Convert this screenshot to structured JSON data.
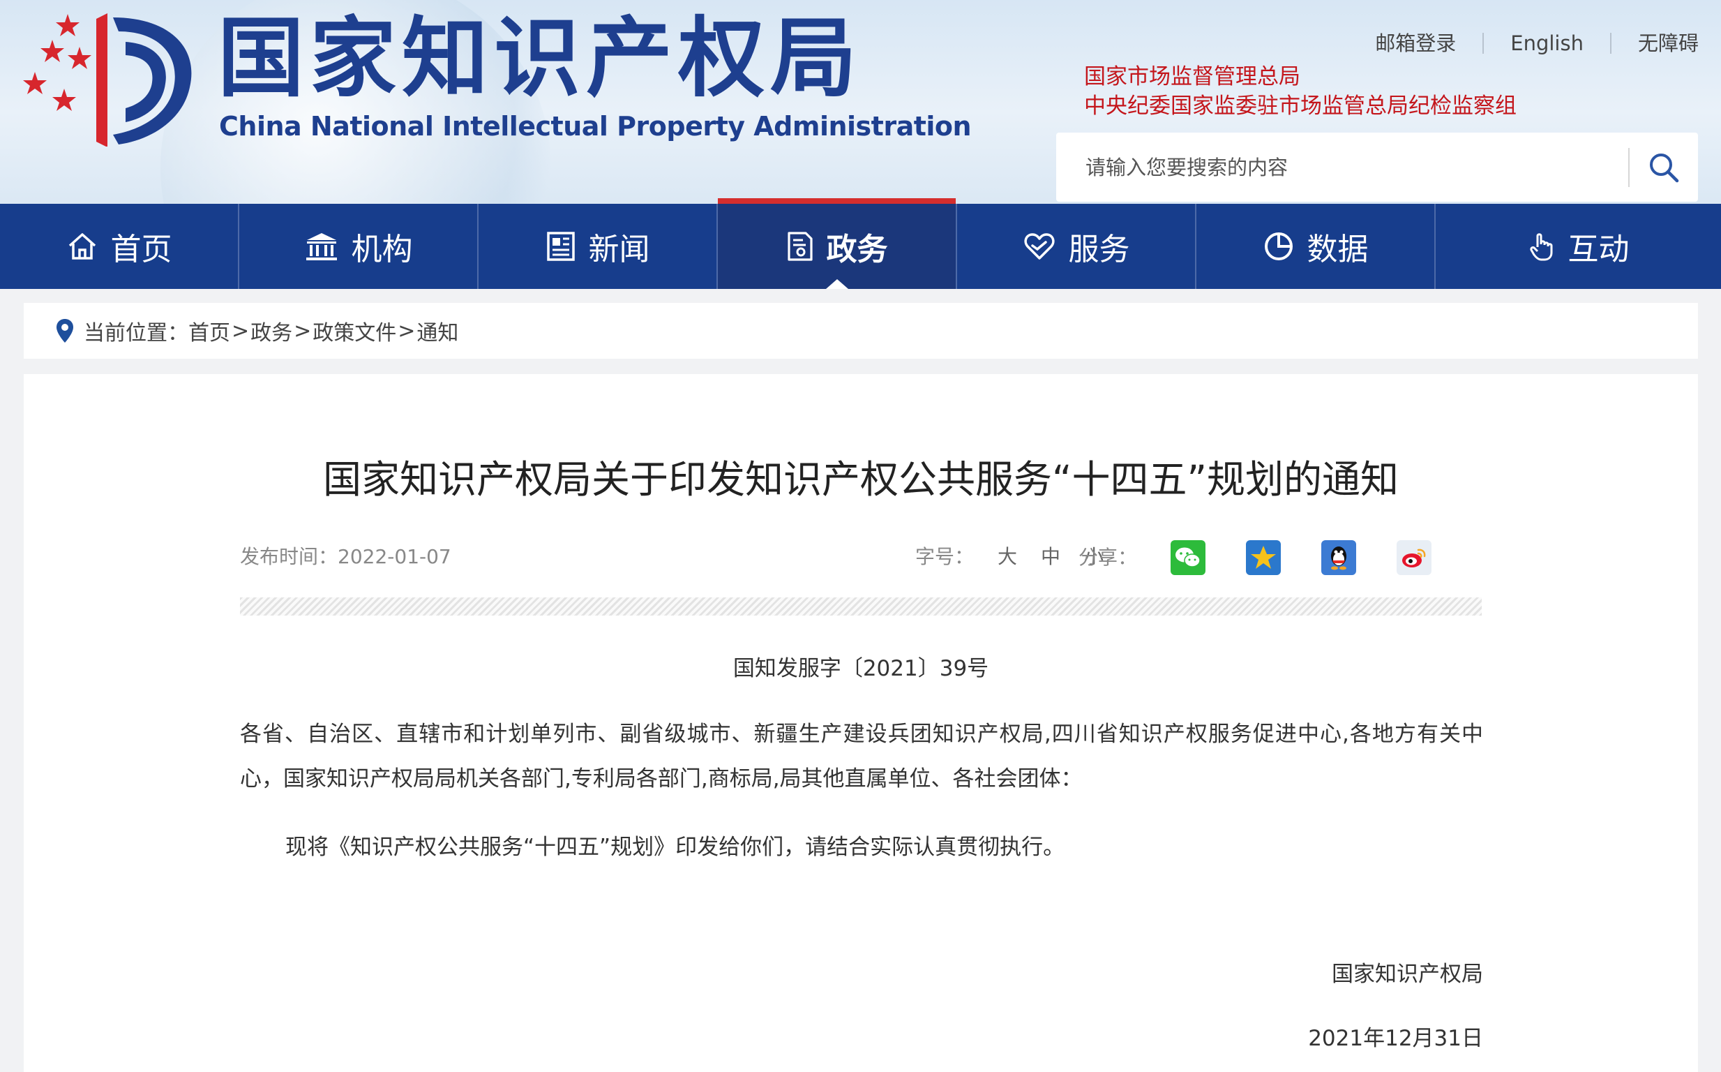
{
  "header": {
    "logo_cn": "国家知识产权局",
    "logo_en": "China National Intellectual Property Administration",
    "top_links": [
      "邮箱登录",
      "English",
      "无障碍"
    ],
    "related_links": [
      "国家市场监督管理总局",
      "中央纪委国家监委驻市场监管总局纪检监察组"
    ],
    "search_placeholder": "请输入您要搜索的内容"
  },
  "nav": {
    "items": [
      {
        "label": "首页",
        "icon": "home-icon"
      },
      {
        "label": "机构",
        "icon": "institution-icon"
      },
      {
        "label": "新闻",
        "icon": "news-icon"
      },
      {
        "label": "政务",
        "icon": "government-affairs-icon",
        "active": true
      },
      {
        "label": "服务",
        "icon": "service-heart-icon"
      },
      {
        "label": "数据",
        "icon": "pie-chart-icon"
      },
      {
        "label": "互动",
        "icon": "touch-hand-icon"
      }
    ],
    "active_color": "#d52e2e",
    "bg_color": "#173d8c"
  },
  "breadcrumb": {
    "prefix": "当前位置：",
    "items": [
      "首页",
      "政务",
      "政策文件",
      "通知"
    ],
    "separator": ">"
  },
  "article": {
    "title": "国家知识产权局关于印发知识产权公共服务“十四五”规划的通知",
    "publish_label": "发布时间：",
    "publish_date": "2022-01-07",
    "font_size_label": "字号：",
    "font_size_options": [
      "大",
      "中",
      "小"
    ],
    "share_label": "分享：",
    "share_targets": [
      "wechat-icon",
      "qzone-icon",
      "qq-icon",
      "weibo-icon"
    ],
    "doc_number": "国知发服字〔2021〕39号",
    "addressees": "各省、自治区、直辖市和计划单列市、副省级城市、新疆生产建设兵团知识产权局,四川省知识产权服务促进中心,各地方有关中心，国家知识产权局局机关各部门,专利局各部门,商标局,局其他直属单位、各社会团体：",
    "paragraph": "现将《知识产权公共服务“十四五”规划》印发给你们，请结合实际认真贯彻执行。",
    "signature": "国家知识产权局",
    "sign_date": "2021年12月31日"
  }
}
